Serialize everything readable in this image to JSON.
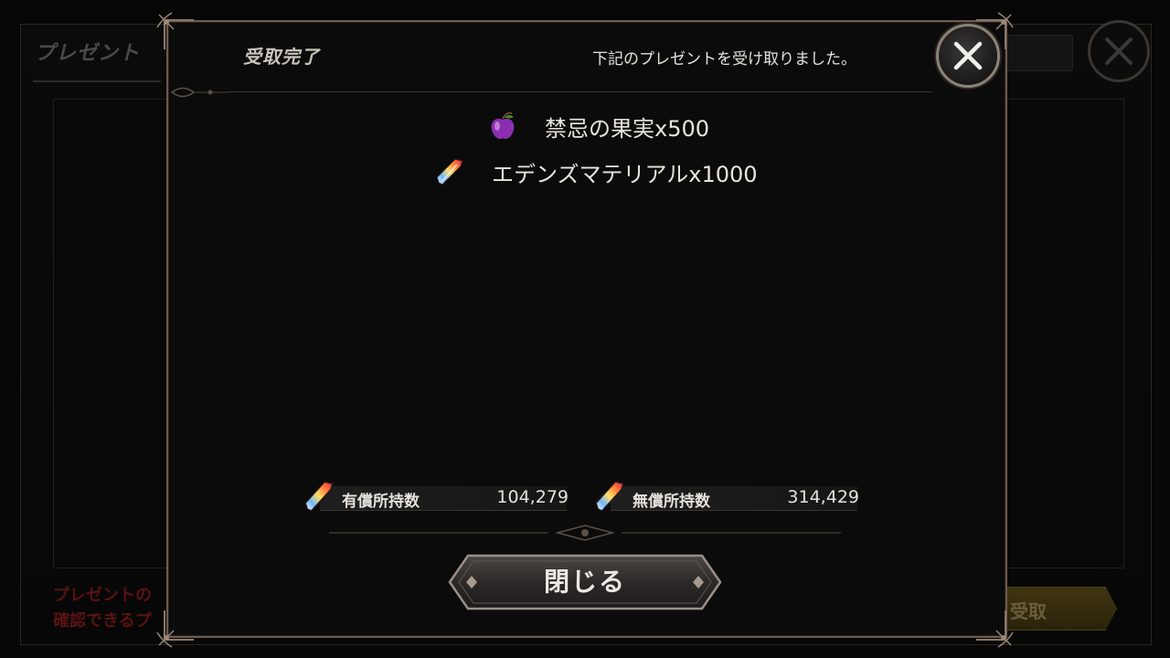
{
  "background": {
    "title": "プレゼント",
    "notice_line1": "プレゼントの",
    "notice_line2": "確認できるプ",
    "receive_button": "受取"
  },
  "modal": {
    "title": "受取完了",
    "message": "下記のプレゼントを受け取りました。",
    "rewards": [
      {
        "name": "禁忌の果実x500",
        "icon": "purple-apple-icon"
      },
      {
        "name": "エデンズマテリアルx1000",
        "icon": "rainbow-crystal-icon"
      }
    ],
    "paid_label": "有償所持数",
    "paid_value": "104,279",
    "free_label": "無償所持数",
    "free_value": "314,429",
    "close_button": "閉じる"
  },
  "colors": {
    "frame": "#6e5a4e",
    "text": "#e6e2dc",
    "accent_red": "#5a1212",
    "apple": "#8b2fb0"
  }
}
